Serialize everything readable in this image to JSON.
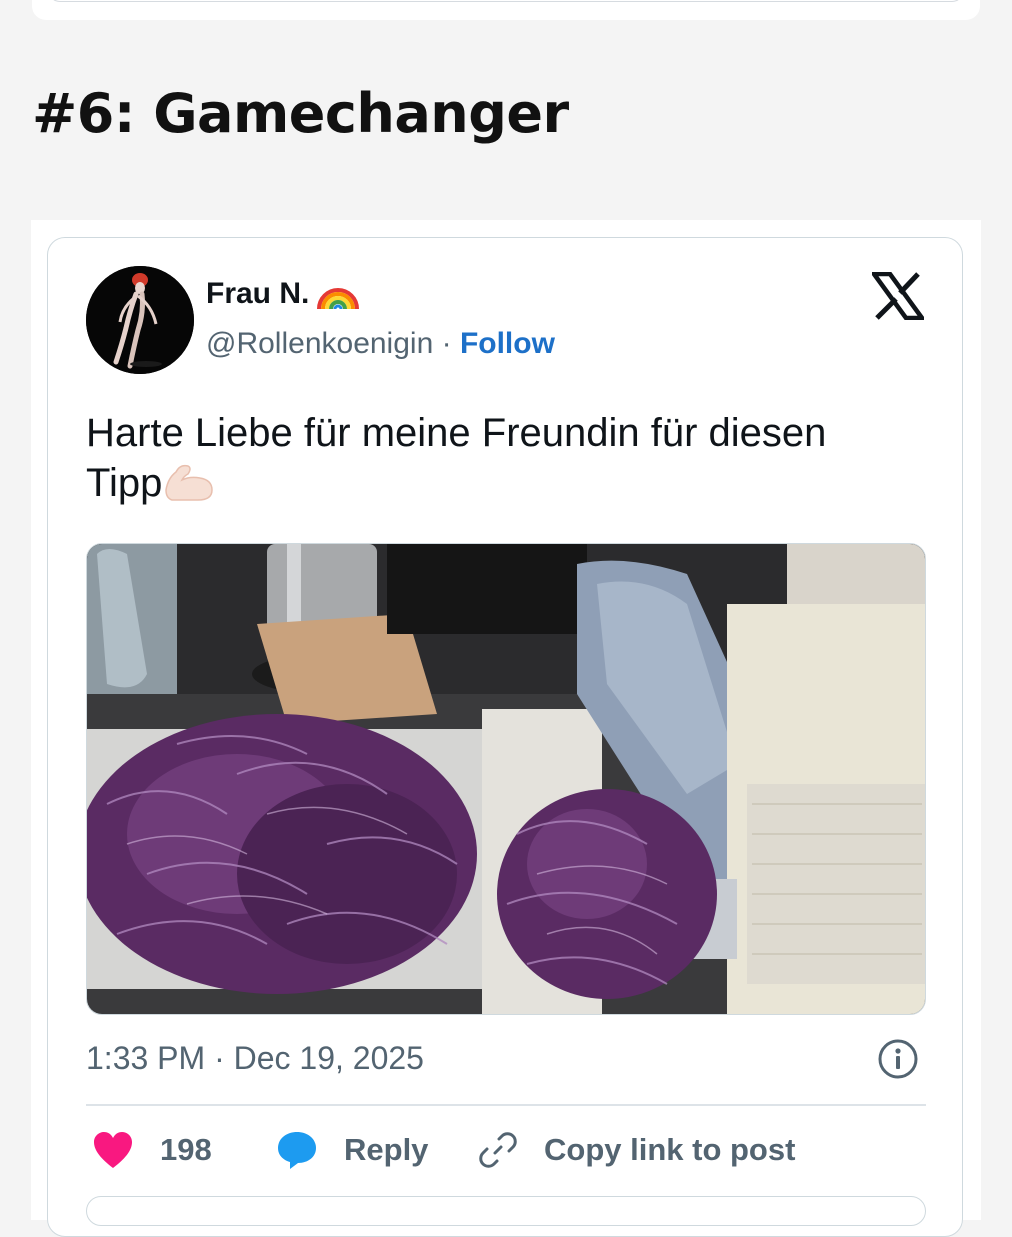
{
  "section": {
    "heading": "#6: Gamechanger"
  },
  "tweet": {
    "author_name": "Frau N.",
    "handle": "@Rollenkoenigin",
    "separator": " · ",
    "follow_label": "Follow",
    "text": "Harte Liebe für meine Freundin für diesen Tipp",
    "timestamp": "1:33 PM · Dec 19, 2025",
    "likes": "198",
    "reply_label": "Reply",
    "copy_link_label": "Copy link to post"
  },
  "icons": {
    "name_badge": "rainbow-icon",
    "text_emoji": "flexed-biceps-icon",
    "brand": "x-logo-icon",
    "info": "info-icon",
    "like": "heart-icon",
    "reply": "speech-bubble-icon",
    "copy": "link-icon"
  },
  "colors": {
    "follow": "#1d70c8",
    "like": "#f91880",
    "reply": "#1d9bf0",
    "text": "#0f1419",
    "muted": "#536471"
  },
  "media": {
    "description_icon": "photo-red-cabbage-slicer"
  }
}
